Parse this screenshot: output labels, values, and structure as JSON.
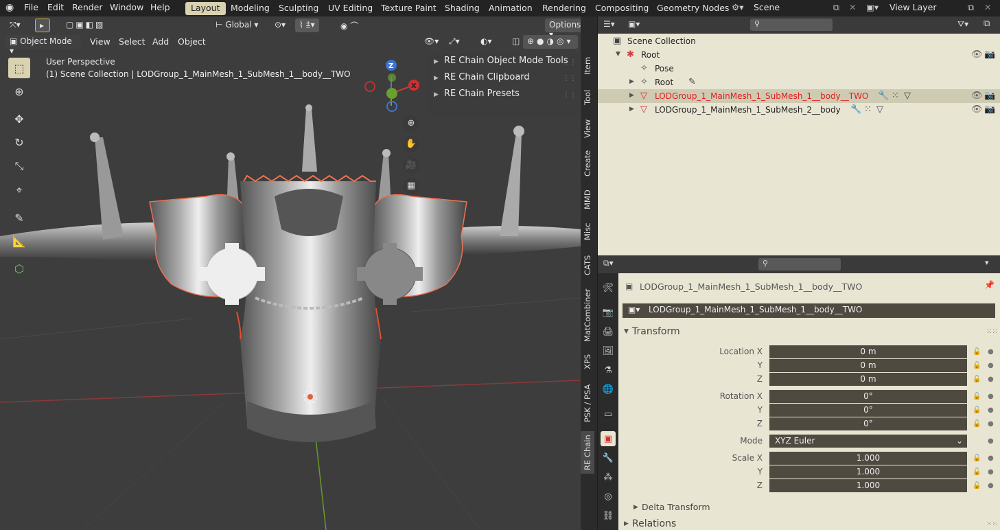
{
  "menu": {
    "file": "File",
    "edit": "Edit",
    "render": "Render",
    "window": "Window",
    "help": "Help"
  },
  "workspaces": [
    "Layout",
    "Modeling",
    "Sculpting",
    "UV Editing",
    "Texture Paint",
    "Shading",
    "Animation",
    "Rendering",
    "Compositing",
    "Geometry Nodes"
  ],
  "scene": {
    "label": "Scene"
  },
  "view_layer": {
    "label": "View Layer"
  },
  "viewport": {
    "transform_orientation": "Global",
    "options": "Options",
    "mode": "Object Mode",
    "menus": [
      "View",
      "Select",
      "Add",
      "Object"
    ],
    "info_line1": "User Perspective",
    "info_line2": "(1) Scene Collection | LODGroup_1_MainMesh_1_SubMesh_1__body__TWO",
    "gizmo_z": "Z",
    "gizmo_x": "X"
  },
  "re_panel": {
    "items": [
      "RE Chain Object Mode Tools",
      "RE Chain Clipboard",
      "RE Chain Presets"
    ]
  },
  "n_tabs": [
    "Item",
    "Tool",
    "View",
    "Create",
    "MMD",
    "Misc",
    "CATS",
    "MatCombiner",
    "XPS",
    "PSK / PSA",
    "RE Chain"
  ],
  "outliner": {
    "rows": [
      {
        "label": "Scene Collection"
      },
      {
        "label": "Root"
      },
      {
        "label": "Pose"
      },
      {
        "label": "Root"
      },
      {
        "label": "LODGroup_1_MainMesh_1_SubMesh_1__body__TWO"
      },
      {
        "label": "LODGroup_1_MainMesh_1_SubMesh_2__body"
      }
    ]
  },
  "properties": {
    "object_name": "LODGroup_1_MainMesh_1_SubMesh_1__body__TWO",
    "object_select": "LODGroup_1_MainMesh_1_SubMesh_1__body__TWO",
    "transform_title": "Transform",
    "location_x_label": "Location X",
    "y_label": "Y",
    "z_label": "Z",
    "location": [
      "0 m",
      "0 m",
      "0 m"
    ],
    "rotation_x_label": "Rotation X",
    "rotation": [
      "0°",
      "0°",
      "0°"
    ],
    "mode_label": "Mode",
    "mode_value": "XYZ Euler",
    "scale_x_label": "Scale X",
    "scale": [
      "1.000",
      "1.000",
      "1.000"
    ],
    "delta_transform": "Delta Transform",
    "relations": "Relations"
  },
  "colors": {
    "accent": "#d9d1b0",
    "selected_red": "#e02020",
    "panel_bg": "#e9e5d3",
    "dark_bg": "#2b2b2b"
  }
}
